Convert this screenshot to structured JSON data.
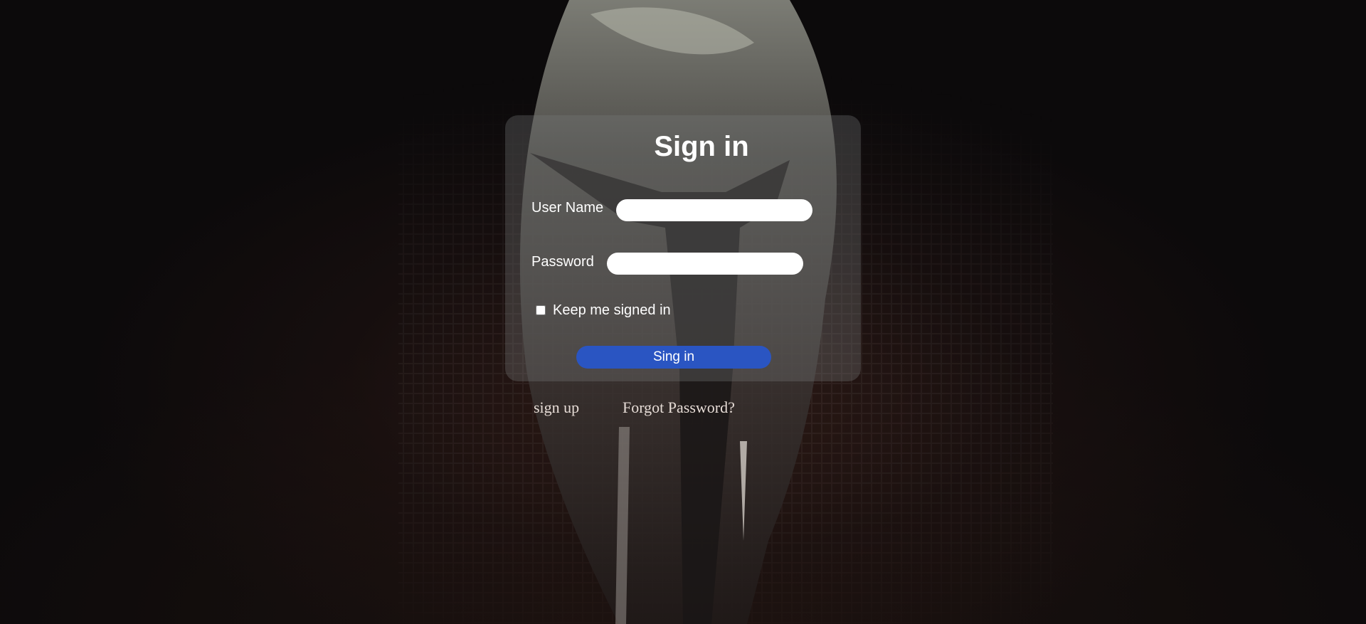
{
  "login": {
    "title": "Sign in",
    "username_label": "User Name",
    "username_value": "",
    "password_label": "Password",
    "password_value": "",
    "remember_label": "Keep me signed in",
    "remember_checked": false,
    "submit_label": "Sing in"
  },
  "links": {
    "signup": "sign up",
    "forgot": "Forgot Password?"
  },
  "colors": {
    "button": "#2a55c2",
    "text": "#ffffff",
    "link": "#e6dcd6"
  }
}
